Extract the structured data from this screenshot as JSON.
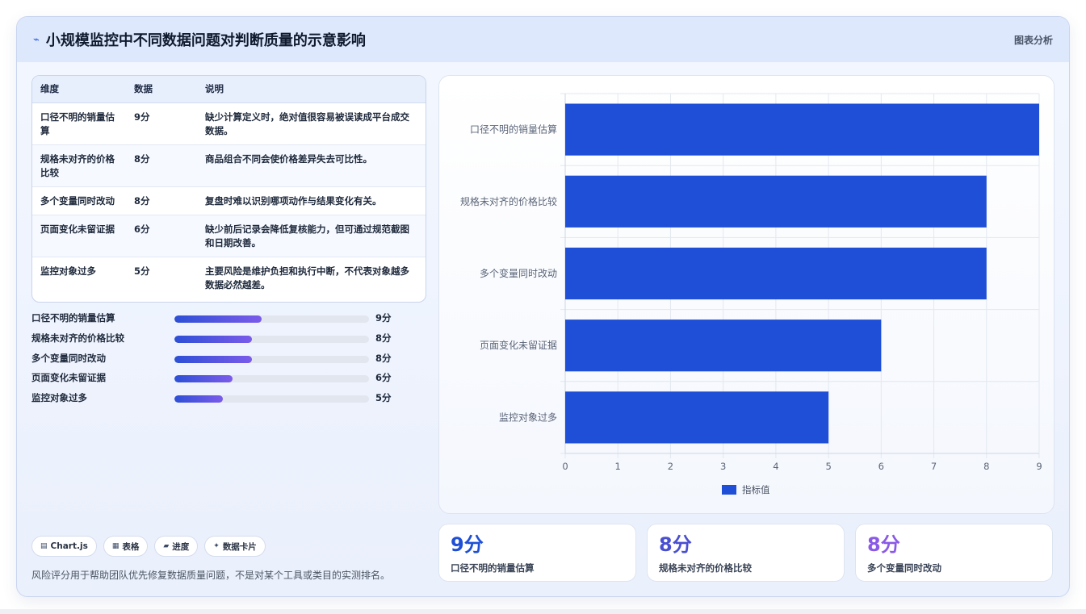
{
  "header": {
    "icon": "⌁",
    "title": "小规模监控中不同数据问题对判断质量的示意影响",
    "tag": "图表分析"
  },
  "table": {
    "headers": [
      "维度",
      "数据",
      "说明"
    ],
    "rows": [
      {
        "dim": "口径不明的销量估算",
        "value": "9分",
        "desc": "缺少计算定义时，绝对值很容易被误读成平台成交数据。"
      },
      {
        "dim": "规格未对齐的价格比较",
        "value": "8分",
        "desc": "商品组合不同会使价格差异失去可比性。"
      },
      {
        "dim": "多个变量同时改动",
        "value": "8分",
        "desc": "复盘时难以识别哪项动作与结果变化有关。"
      },
      {
        "dim": "页面变化未留证据",
        "value": "6分",
        "desc": "缺少前后记录会降低复核能力，但可通过规范截图和日期改善。"
      },
      {
        "dim": "监控对象过多",
        "value": "5分",
        "desc": "主要风险是维护负担和执行中断，不代表对象越多数据必然越差。"
      }
    ]
  },
  "progress": [
    {
      "label": "口径不明的销量估算",
      "value_text": "9分",
      "fraction": 0.45
    },
    {
      "label": "规格未对齐的价格比较",
      "value_text": "8分",
      "fraction": 0.4
    },
    {
      "label": "多个变量同时改动",
      "value_text": "8分",
      "fraction": 0.4
    },
    {
      "label": "页面变化未留证据",
      "value_text": "6分",
      "fraction": 0.3
    },
    {
      "label": "监控对象过多",
      "value_text": "5分",
      "fraction": 0.25
    }
  ],
  "chips": [
    {
      "icon": "▤",
      "label": "Chart.js"
    },
    {
      "icon": "▦",
      "label": "表格"
    },
    {
      "icon": "▰",
      "label": "进度"
    },
    {
      "icon": "✦",
      "label": "数据卡片"
    }
  ],
  "footnote": "风险评分用于帮助团队优先修复数据质量问题，不是对某个工具或类目的实测排名。",
  "chart_data": {
    "type": "bar",
    "orientation": "horizontal",
    "categories": [
      "口径不明的销量估算",
      "规格未对齐的价格比较",
      "多个变量同时改动",
      "页面变化未留证据",
      "监控对象过多"
    ],
    "series": [
      {
        "name": "指标值",
        "values": [
          9,
          8,
          8,
          6,
          5
        ]
      }
    ],
    "xlim": [
      0,
      9
    ],
    "xticks": [
      "0",
      "1",
      "2",
      "3",
      "4",
      "5",
      "6",
      "7",
      "8",
      "9"
    ],
    "grid": true,
    "legend": "bottom",
    "bar_color": "#1f4fd6"
  },
  "stats": [
    {
      "value": "9分",
      "label": "口径不明的销量估算",
      "color": "#1f4fd6"
    },
    {
      "value": "8分",
      "label": "规格未对齐的价格比较",
      "color": "#4a4fd0"
    },
    {
      "value": "8分",
      "label": "多个变量同时改动",
      "color": "#8a5ae6"
    }
  ]
}
